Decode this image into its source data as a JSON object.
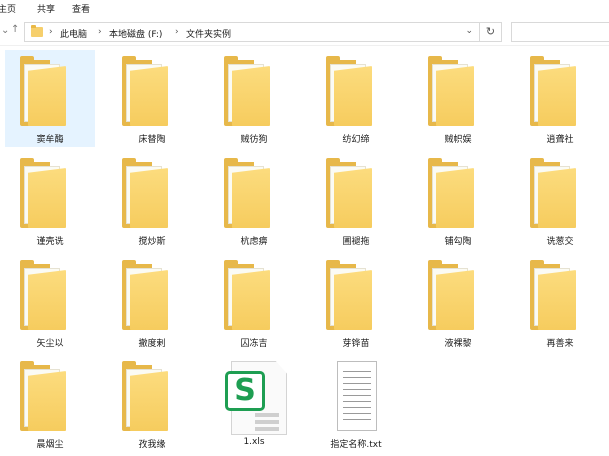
{
  "ribbon": {
    "tabs": [
      "主页",
      "共享",
      "查看"
    ]
  },
  "nav": {
    "back_icon": "←",
    "forward_icon": "→",
    "dropdown_icon": "⌄",
    "up_icon": "↑"
  },
  "address": {
    "crumbs": [
      "此电脑",
      "本地磁盘 (F:)",
      "文件夹实例"
    ],
    "separator": "›",
    "dropdown_icon": "⌄",
    "refresh_icon": "↻"
  },
  "search": {
    "placeholder": ""
  },
  "items": [
    {
      "name": "窦牟酶",
      "type": "folder",
      "selected": true
    },
    {
      "name": "床替陶",
      "type": "folder"
    },
    {
      "name": "贼彷狗",
      "type": "folder"
    },
    {
      "name": "纺幻缔",
      "type": "folder"
    },
    {
      "name": "贼帜娱",
      "type": "folder"
    },
    {
      "name": "逍聋社",
      "type": "folder"
    },
    {
      "name": "谨壳诜",
      "type": "folder"
    },
    {
      "name": "搅炒斯",
      "type": "folder"
    },
    {
      "name": "杭虑痹",
      "type": "folder"
    },
    {
      "name": "圃褪拖",
      "type": "folder"
    },
    {
      "name": "铺勾陶",
      "type": "folder"
    },
    {
      "name": "诜葱交",
      "type": "folder"
    },
    {
      "name": "矢尘以",
      "type": "folder"
    },
    {
      "name": "撤度剌",
      "type": "folder"
    },
    {
      "name": "囚冻吉",
      "type": "folder"
    },
    {
      "name": "芽铧苗",
      "type": "folder"
    },
    {
      "name": "液裸黎",
      "type": "folder"
    },
    {
      "name": "再善来",
      "type": "folder"
    },
    {
      "name": "晨烟尘",
      "type": "folder"
    },
    {
      "name": "孜我缘",
      "type": "folder"
    },
    {
      "name": "1.xls",
      "type": "xls",
      "badge": "S"
    },
    {
      "name": "指定名称.txt",
      "type": "txt"
    }
  ],
  "colors": {
    "folder_front": "#f6cc5e",
    "folder_back": "#e7b84a",
    "selection": "#e5f3ff",
    "xls_green": "#1e9e52"
  }
}
